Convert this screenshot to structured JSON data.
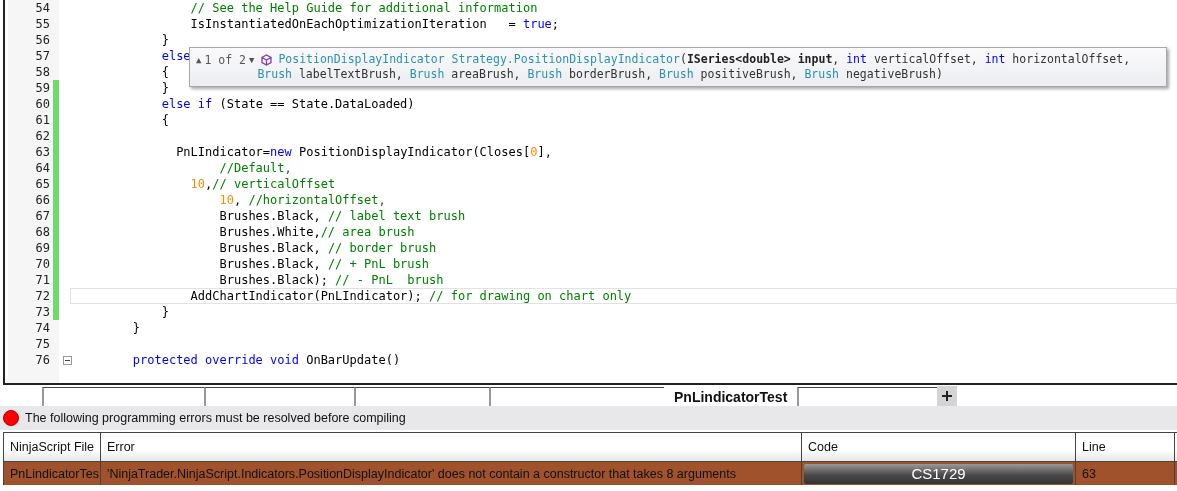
{
  "editor": {
    "lines": [
      {
        "number": "54",
        "changed": false,
        "current": false,
        "tokens": [
          {
            "kind": "comment",
            "text": "                // See the Help Guide for additional information"
          }
        ]
      },
      {
        "number": "55",
        "changed": false,
        "current": false,
        "tokens": [
          {
            "kind": "plain",
            "text": "                IsInstantiatedOnEachOptimizationIteration   = "
          },
          {
            "kind": "keyword",
            "text": "true"
          },
          {
            "kind": "plain",
            "text": ";"
          }
        ]
      },
      {
        "number": "56",
        "changed": false,
        "current": false,
        "tokens": [
          {
            "kind": "plain",
            "text": "            }"
          }
        ]
      },
      {
        "number": "57",
        "changed": false,
        "current": false,
        "tokens": [
          {
            "kind": "keyword",
            "text": "            else"
          }
        ]
      },
      {
        "number": "58",
        "changed": false,
        "current": false,
        "tokens": [
          {
            "kind": "plain",
            "text": "            {"
          }
        ]
      },
      {
        "number": "59",
        "changed": true,
        "current": false,
        "tokens": [
          {
            "kind": "plain",
            "text": "            }"
          }
        ]
      },
      {
        "number": "60",
        "changed": true,
        "current": false,
        "tokens": [
          {
            "kind": "keyword",
            "text": "            else if"
          },
          {
            "kind": "plain",
            "text": " (State == State.DataLoaded)"
          }
        ]
      },
      {
        "number": "61",
        "changed": true,
        "current": false,
        "tokens": [
          {
            "kind": "plain",
            "text": "            {"
          }
        ]
      },
      {
        "number": "62",
        "changed": true,
        "current": false
      },
      {
        "number": "63",
        "changed": true,
        "current": false,
        "tokens": [
          {
            "kind": "plain",
            "text": "              PnLIndicator="
          },
          {
            "kind": "keyword",
            "text": "new"
          },
          {
            "kind": "plain",
            "text": " PositionDisplayIndicator(Closes["
          },
          {
            "kind": "number",
            "text": "0"
          },
          {
            "kind": "plain",
            "text": "],"
          }
        ]
      },
      {
        "number": "64",
        "changed": true,
        "current": false,
        "tokens": [
          {
            "kind": "comment",
            "text": "                    //Default,"
          }
        ]
      },
      {
        "number": "65",
        "changed": true,
        "current": false,
        "tokens": [
          {
            "kind": "number",
            "text": "                10"
          },
          {
            "kind": "plain",
            "text": ","
          },
          {
            "kind": "comment",
            "text": "// verticalOffset"
          }
        ]
      },
      {
        "number": "66",
        "changed": true,
        "current": false,
        "tokens": [
          {
            "kind": "number",
            "text": "                    10"
          },
          {
            "kind": "plain",
            "text": ", "
          },
          {
            "kind": "comment",
            "text": "//horizontalOffset,"
          }
        ]
      },
      {
        "number": "67",
        "changed": true,
        "current": false,
        "tokens": [
          {
            "kind": "plain",
            "text": "                    Brushes.Black, "
          },
          {
            "kind": "comment",
            "text": "// label text brush"
          }
        ]
      },
      {
        "number": "68",
        "changed": true,
        "current": false,
        "tokens": [
          {
            "kind": "plain",
            "text": "                    Brushes.White,"
          },
          {
            "kind": "comment",
            "text": "// area brush"
          }
        ]
      },
      {
        "number": "69",
        "changed": true,
        "current": false,
        "tokens": [
          {
            "kind": "plain",
            "text": "                    Brushes.Black, "
          },
          {
            "kind": "comment",
            "text": "// border brush"
          }
        ]
      },
      {
        "number": "70",
        "changed": true,
        "current": false,
        "tokens": [
          {
            "kind": "plain",
            "text": "                    Brushes.Black, "
          },
          {
            "kind": "comment",
            "text": "// + PnL brush"
          }
        ]
      },
      {
        "number": "71",
        "changed": true,
        "current": false,
        "tokens": [
          {
            "kind": "plain",
            "text": "                    Brushes.Black); "
          },
          {
            "kind": "comment",
            "text": "// - PnL  brush"
          }
        ]
      },
      {
        "number": "72",
        "changed": true,
        "current": true,
        "tokens": [
          {
            "kind": "plain",
            "text": "                AddChartIndicator(PnLIndicator); "
          },
          {
            "kind": "comment",
            "text": "// for drawing on chart only"
          }
        ]
      },
      {
        "number": "73",
        "changed": true,
        "current": false,
        "tokens": [
          {
            "kind": "plain",
            "text": "            }"
          }
        ]
      },
      {
        "number": "74",
        "changed": false,
        "current": false,
        "tokens": [
          {
            "kind": "plain",
            "text": "        }"
          }
        ]
      },
      {
        "number": "75",
        "changed": false,
        "current": false
      },
      {
        "number": "76",
        "changed": false,
        "current": false,
        "collapsible": true,
        "tokens": [
          {
            "kind": "keyword",
            "text": "        protected override void"
          },
          {
            "kind": "plain",
            "text": " OnBarUpdate()"
          }
        ]
      }
    ]
  },
  "signature_tooltip": {
    "previous": "▲",
    "counter": "1 of 2",
    "next": "▼",
    "lines": [
      [
        {
          "kind": "type",
          "text": "PositionDisplayIndicator Strategy.PositionDisplayIndicator"
        },
        {
          "kind": "plain",
          "text": "("
        },
        {
          "kind": "bold",
          "text": "ISeries<double> input"
        },
        {
          "kind": "plain",
          "text": ", "
        },
        {
          "kind": "keyword",
          "text": "int"
        },
        {
          "kind": "plain",
          "text": " verticalOffset, "
        },
        {
          "kind": "keyword",
          "text": "int"
        },
        {
          "kind": "plain",
          "text": " horizontalOffset,"
        }
      ],
      [
        {
          "kind": "type",
          "text": "Brush"
        },
        {
          "kind": "plain",
          "text": " labelTextBrush, "
        },
        {
          "kind": "type",
          "text": "Brush"
        },
        {
          "kind": "plain",
          "text": " areaBrush, "
        },
        {
          "kind": "type",
          "text": "Brush"
        },
        {
          "kind": "plain",
          "text": " borderBrush, "
        },
        {
          "kind": "type",
          "text": "Brush"
        },
        {
          "kind": "plain",
          "text": " positiveBrush, "
        },
        {
          "kind": "type",
          "text": "Brush"
        },
        {
          "kind": "plain",
          "text": " negativeBrush)"
        }
      ]
    ]
  },
  "tabs": [
    {
      "label": "PnLindicatorTest",
      "selected": true
    }
  ],
  "error_banner": {
    "message": "The following programming errors must be resolved before compiling"
  },
  "error_table": {
    "columns": [
      "NinjaScript File",
      "Error",
      "Code",
      "Line"
    ],
    "rows": [
      {
        "file": "PnLindicatorTes",
        "error": "'NinjaTrader.NinjaScript.Indicators.PositionDisplayIndicator' does not contain a constructor that takes 8 arguments",
        "code": "CS1729",
        "line": "63",
        "selected": true
      }
    ]
  }
}
